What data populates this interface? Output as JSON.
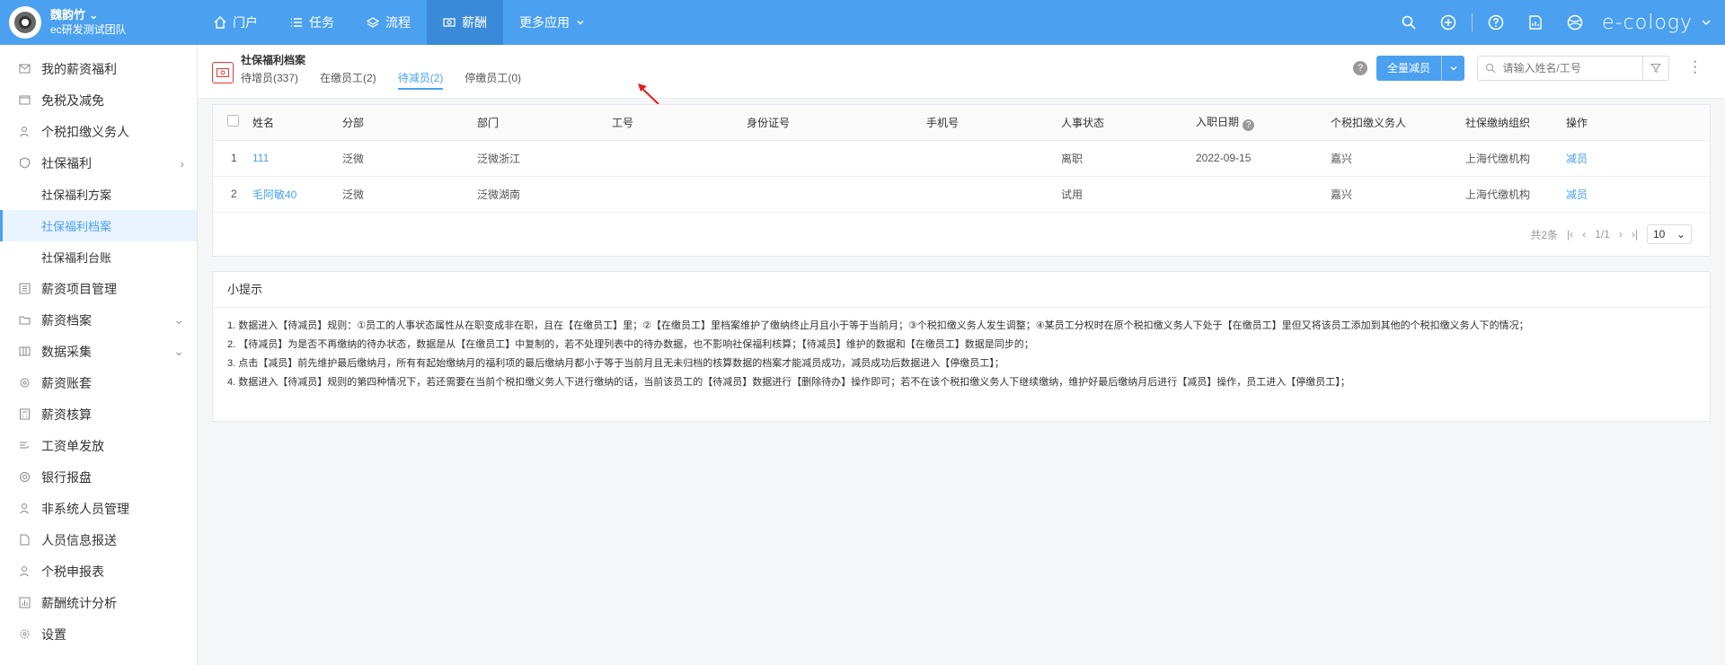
{
  "header": {
    "user_name": "魏韵竹",
    "team": "ec研发测试团队",
    "nav": [
      {
        "label": "门户",
        "icon": "home-icon"
      },
      {
        "label": "任务",
        "icon": "list-icon"
      },
      {
        "label": "流程",
        "icon": "layers-icon"
      },
      {
        "label": "薪酬",
        "icon": "money-icon"
      },
      {
        "label": "更多应用",
        "icon": "chevron-down-icon"
      }
    ],
    "brand": "e-cology"
  },
  "sidebar": {
    "items": [
      {
        "label": "我的薪资福利"
      },
      {
        "label": "免税及减免"
      },
      {
        "label": "个税扣缴义务人"
      },
      {
        "label": "社保福利"
      },
      {
        "label": "社保福利方案"
      },
      {
        "label": "社保福利档案"
      },
      {
        "label": "社保福利台账"
      },
      {
        "label": "薪资项目管理"
      },
      {
        "label": "薪资档案"
      },
      {
        "label": "数据采集"
      },
      {
        "label": "薪资账套"
      },
      {
        "label": "薪资核算"
      },
      {
        "label": "工资单发放"
      },
      {
        "label": "银行报盘"
      },
      {
        "label": "非系统人员管理"
      },
      {
        "label": "人员信息报送"
      },
      {
        "label": "个税申报表"
      },
      {
        "label": "薪酬统计分析"
      },
      {
        "label": "设置"
      }
    ]
  },
  "page": {
    "title": "社保福利档案",
    "tabs": [
      "待增员(337)",
      "在缴员工(2)",
      "待减员(2)",
      "停缴员工(0)"
    ],
    "primary_button": "全量减员",
    "search_placeholder": "请输入姓名/工号"
  },
  "table": {
    "columns": [
      "姓名",
      "分部",
      "部门",
      "工号",
      "身份证号",
      "手机号",
      "人事状态",
      "入职日期",
      "个税扣缴义务人",
      "社保缴纳组织",
      "操作"
    ],
    "rows": [
      {
        "index": "1",
        "name": "111",
        "branch": "泛微",
        "dept": "泛微浙江",
        "emp_no": "",
        "id_no": "",
        "phone": "",
        "status": "离职",
        "hire_date": "2022-09-15",
        "tax_agent": "嘉兴",
        "org": "上海代缴机构",
        "action": "减员"
      },
      {
        "index": "2",
        "name": "毛阿敏40",
        "branch": "泛微",
        "dept": "泛微湖南",
        "emp_no": "",
        "id_no": "",
        "phone": "",
        "status": "试用",
        "hire_date": "",
        "tax_agent": "嘉兴",
        "org": "上海代缴机构",
        "action": "减员"
      }
    ],
    "pager": {
      "total": "共2条",
      "page": "1/1",
      "size": "10"
    }
  },
  "tips": {
    "title": "小提示",
    "lines": [
      "1. 数据进入【待减员】规则：①员工的人事状态属性从在职变成非在职，且在【在缴员工】里；②【在缴员工】里档案维护了缴纳终止月且小于等于当前月；③个税扣缴义务人发生调整；④某员工分权时在原个税扣缴义务人下处于【在缴员工】里但又将该员工添加到其他的个税扣缴义务人下的情况；",
      "2. 【待减员】为是否不再缴纳的待办状态，数据是从【在缴员工】中复制的，若不处理列表中的待办数据，也不影响社保福利核算；【待减员】维护的数据和【在缴员工】数据是同步的；",
      "3. 点击【减员】前先维护最后缴纳月，所有有起始缴纳月的福利项的最后缴纳月都小于等于当前月且无未归档的核算数据的档案才能减员成功，减员成功后数据进入【停缴员工】；",
      "4. 数据进入【待减员】规则的第四种情况下，若还需要在当前个税扣缴义务人下进行缴纳的话，当前该员工的【待减员】数据进行【删除待办】操作即可；若不在该个税扣缴义务人下继续缴纳，维护好最后缴纳月后进行【减员】操作，员工进入【停缴员工】；"
    ]
  },
  "colors": {
    "accent": "#4ba1ef",
    "arrow": "#e02020"
  }
}
